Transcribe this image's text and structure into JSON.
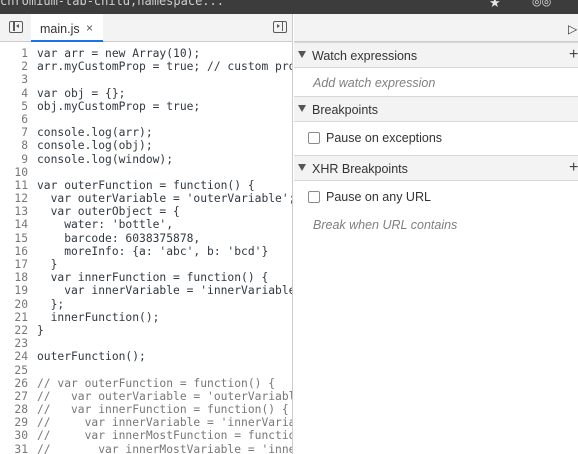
{
  "browser": {
    "tab_text": "chromium-tab-child,namespace...",
    "star_icon": "star-icon",
    "extension_icon": "extension-icon"
  },
  "editor": {
    "file_tab": {
      "label": "main.js",
      "close": "×"
    },
    "lines": [
      {
        "n": "1",
        "text": "var arr = new Array(10);",
        "type": "code"
      },
      {
        "n": "2",
        "text": "arr.myCustomProp = true; // custom prop",
        "type": "code"
      },
      {
        "n": "3",
        "text": "",
        "type": "code"
      },
      {
        "n": "4",
        "text": "var obj = {};",
        "type": "code"
      },
      {
        "n": "5",
        "text": "obj.myCustomProp = true;",
        "type": "code"
      },
      {
        "n": "6",
        "text": "",
        "type": "code"
      },
      {
        "n": "7",
        "text": "console.log(arr);",
        "type": "code"
      },
      {
        "n": "8",
        "text": "console.log(obj);",
        "type": "code"
      },
      {
        "n": "9",
        "text": "console.log(window);",
        "type": "code"
      },
      {
        "n": "10",
        "text": "",
        "type": "code"
      },
      {
        "n": "11",
        "text": "var outerFunction = function() {",
        "type": "code"
      },
      {
        "n": "12",
        "text": "  var outerVariable = 'outerVariable';",
        "type": "code"
      },
      {
        "n": "13",
        "text": "  var outerObject = {",
        "type": "code"
      },
      {
        "n": "14",
        "text": "    water: 'bottle',",
        "type": "code"
      },
      {
        "n": "15",
        "text": "    barcode: 6038375878,",
        "type": "code"
      },
      {
        "n": "16",
        "text": "    moreInfo: {a: 'abc', b: 'bcd'}",
        "type": "code"
      },
      {
        "n": "17",
        "text": "  }",
        "type": "code"
      },
      {
        "n": "18",
        "text": "  var innerFunction = function() {",
        "type": "code"
      },
      {
        "n": "19",
        "text": "    var innerVariable = 'innerVariable'",
        "type": "code"
      },
      {
        "n": "20",
        "text": "  };",
        "type": "code"
      },
      {
        "n": "21",
        "text": "  innerFunction();",
        "type": "code"
      },
      {
        "n": "22",
        "text": "}",
        "type": "code"
      },
      {
        "n": "23",
        "text": "",
        "type": "code"
      },
      {
        "n": "24",
        "text": "outerFunction();",
        "type": "code"
      },
      {
        "n": "25",
        "text": "",
        "type": "code"
      },
      {
        "n": "26",
        "text": "// var outerFunction = function() {",
        "type": "comment"
      },
      {
        "n": "27",
        "text": "//   var outerVariable = 'outerVariable",
        "type": "comment"
      },
      {
        "n": "28",
        "text": "//   var innerFunction = function() {",
        "type": "comment"
      },
      {
        "n": "29",
        "text": "//     var innerVariable = 'innerVariab",
        "type": "comment"
      },
      {
        "n": "30",
        "text": "//     var innerMostFunction = functio",
        "type": "comment"
      },
      {
        "n": "31",
        "text": "//       var innerMostVariable = 'inner",
        "type": "comment"
      }
    ]
  },
  "debugger": {
    "watch": {
      "title": "Watch expressions",
      "add_hint": "Add watch expression",
      "plus": "+"
    },
    "breakpoints": {
      "title": "Breakpoints",
      "pause_on_exceptions": "Pause on exceptions"
    },
    "xhr": {
      "title": "XHR Breakpoints",
      "pause_on_any_url": "Pause on any URL",
      "url_hint": "Break when URL contains",
      "plus": "+"
    }
  }
}
